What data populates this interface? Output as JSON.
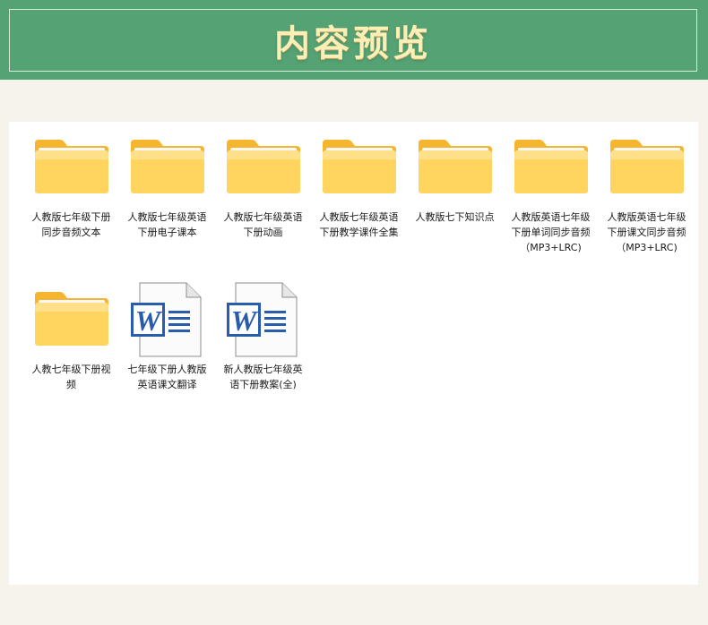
{
  "header": {
    "title": "内容预览"
  },
  "files": [
    {
      "name": "人教版七年级下册同步音频文本",
      "icon": "folder-icon"
    },
    {
      "name": "人教版七年级英语下册电子课本",
      "icon": "folder-icon"
    },
    {
      "name": "人教版七年级英语下册动画",
      "icon": "folder-icon"
    },
    {
      "name": "人教版七年级英语下册教学课件全集",
      "icon": "folder-icon"
    },
    {
      "name": "人教版七下知识点",
      "icon": "folder-icon"
    },
    {
      "name": "人教版英语七年级下册单词同步音频（MP3+LRC)",
      "icon": "folder-icon"
    },
    {
      "name": "人教版英语七年级下册课文同步音频（MP3+LRC)",
      "icon": "folder-icon"
    },
    {
      "name": "人教七年级下册视频",
      "icon": "folder-icon"
    },
    {
      "name": "七年级下册人教版英语课文翻译",
      "icon": "word-document-icon"
    },
    {
      "name": "新人教版七年级英语下册教案(全)",
      "icon": "word-document-icon"
    }
  ],
  "colors": {
    "banner": "#55a274",
    "title": "#fbefb8",
    "folder": "#ffd45c",
    "word": "#2a5cad"
  }
}
